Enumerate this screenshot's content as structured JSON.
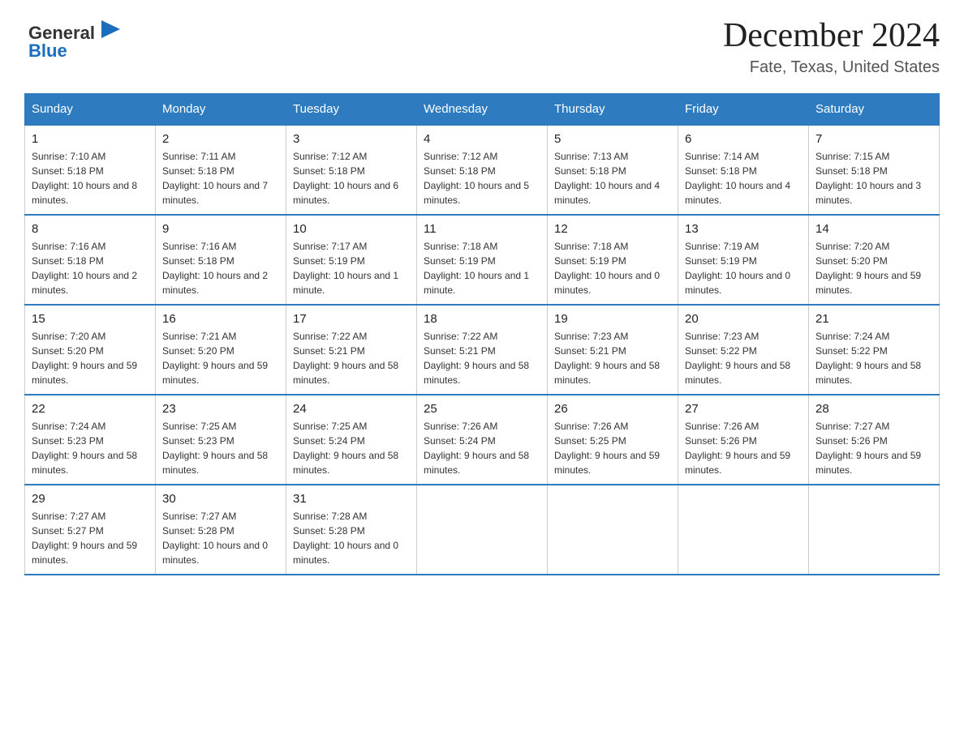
{
  "header": {
    "logo_text_general": "General",
    "logo_text_blue": "Blue",
    "month_title": "December 2024",
    "location": "Fate, Texas, United States"
  },
  "weekdays": [
    "Sunday",
    "Monday",
    "Tuesday",
    "Wednesday",
    "Thursday",
    "Friday",
    "Saturday"
  ],
  "weeks": [
    [
      {
        "day": "1",
        "sunrise": "7:10 AM",
        "sunset": "5:18 PM",
        "daylight": "10 hours and 8 minutes."
      },
      {
        "day": "2",
        "sunrise": "7:11 AM",
        "sunset": "5:18 PM",
        "daylight": "10 hours and 7 minutes."
      },
      {
        "day": "3",
        "sunrise": "7:12 AM",
        "sunset": "5:18 PM",
        "daylight": "10 hours and 6 minutes."
      },
      {
        "day": "4",
        "sunrise": "7:12 AM",
        "sunset": "5:18 PM",
        "daylight": "10 hours and 5 minutes."
      },
      {
        "day": "5",
        "sunrise": "7:13 AM",
        "sunset": "5:18 PM",
        "daylight": "10 hours and 4 minutes."
      },
      {
        "day": "6",
        "sunrise": "7:14 AM",
        "sunset": "5:18 PM",
        "daylight": "10 hours and 4 minutes."
      },
      {
        "day": "7",
        "sunrise": "7:15 AM",
        "sunset": "5:18 PM",
        "daylight": "10 hours and 3 minutes."
      }
    ],
    [
      {
        "day": "8",
        "sunrise": "7:16 AM",
        "sunset": "5:18 PM",
        "daylight": "10 hours and 2 minutes."
      },
      {
        "day": "9",
        "sunrise": "7:16 AM",
        "sunset": "5:18 PM",
        "daylight": "10 hours and 2 minutes."
      },
      {
        "day": "10",
        "sunrise": "7:17 AM",
        "sunset": "5:19 PM",
        "daylight": "10 hours and 1 minute."
      },
      {
        "day": "11",
        "sunrise": "7:18 AM",
        "sunset": "5:19 PM",
        "daylight": "10 hours and 1 minute."
      },
      {
        "day": "12",
        "sunrise": "7:18 AM",
        "sunset": "5:19 PM",
        "daylight": "10 hours and 0 minutes."
      },
      {
        "day": "13",
        "sunrise": "7:19 AM",
        "sunset": "5:19 PM",
        "daylight": "10 hours and 0 minutes."
      },
      {
        "day": "14",
        "sunrise": "7:20 AM",
        "sunset": "5:20 PM",
        "daylight": "9 hours and 59 minutes."
      }
    ],
    [
      {
        "day": "15",
        "sunrise": "7:20 AM",
        "sunset": "5:20 PM",
        "daylight": "9 hours and 59 minutes."
      },
      {
        "day": "16",
        "sunrise": "7:21 AM",
        "sunset": "5:20 PM",
        "daylight": "9 hours and 59 minutes."
      },
      {
        "day": "17",
        "sunrise": "7:22 AM",
        "sunset": "5:21 PM",
        "daylight": "9 hours and 58 minutes."
      },
      {
        "day": "18",
        "sunrise": "7:22 AM",
        "sunset": "5:21 PM",
        "daylight": "9 hours and 58 minutes."
      },
      {
        "day": "19",
        "sunrise": "7:23 AM",
        "sunset": "5:21 PM",
        "daylight": "9 hours and 58 minutes."
      },
      {
        "day": "20",
        "sunrise": "7:23 AM",
        "sunset": "5:22 PM",
        "daylight": "9 hours and 58 minutes."
      },
      {
        "day": "21",
        "sunrise": "7:24 AM",
        "sunset": "5:22 PM",
        "daylight": "9 hours and 58 minutes."
      }
    ],
    [
      {
        "day": "22",
        "sunrise": "7:24 AM",
        "sunset": "5:23 PM",
        "daylight": "9 hours and 58 minutes."
      },
      {
        "day": "23",
        "sunrise": "7:25 AM",
        "sunset": "5:23 PM",
        "daylight": "9 hours and 58 minutes."
      },
      {
        "day": "24",
        "sunrise": "7:25 AM",
        "sunset": "5:24 PM",
        "daylight": "9 hours and 58 minutes."
      },
      {
        "day": "25",
        "sunrise": "7:26 AM",
        "sunset": "5:24 PM",
        "daylight": "9 hours and 58 minutes."
      },
      {
        "day": "26",
        "sunrise": "7:26 AM",
        "sunset": "5:25 PM",
        "daylight": "9 hours and 59 minutes."
      },
      {
        "day": "27",
        "sunrise": "7:26 AM",
        "sunset": "5:26 PM",
        "daylight": "9 hours and 59 minutes."
      },
      {
        "day": "28",
        "sunrise": "7:27 AM",
        "sunset": "5:26 PM",
        "daylight": "9 hours and 59 minutes."
      }
    ],
    [
      {
        "day": "29",
        "sunrise": "7:27 AM",
        "sunset": "5:27 PM",
        "daylight": "9 hours and 59 minutes."
      },
      {
        "day": "30",
        "sunrise": "7:27 AM",
        "sunset": "5:28 PM",
        "daylight": "10 hours and 0 minutes."
      },
      {
        "day": "31",
        "sunrise": "7:28 AM",
        "sunset": "5:28 PM",
        "daylight": "10 hours and 0 minutes."
      },
      null,
      null,
      null,
      null
    ]
  ]
}
